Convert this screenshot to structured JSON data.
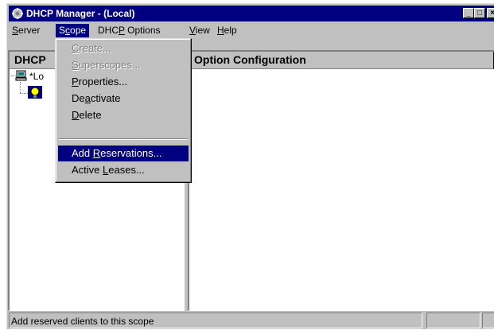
{
  "window": {
    "title": "DHCP Manager - (Local)",
    "icon": "dhcp-manager-icon",
    "controls": {
      "minimize": "_",
      "maximize": "□",
      "close": "×"
    }
  },
  "menubar": {
    "items": [
      {
        "pre": "",
        "key": "S",
        "post": "erver"
      },
      {
        "pre": "S",
        "key": "c",
        "post": "ope"
      },
      {
        "pre": "DHC",
        "key": "P",
        "post": " Options"
      },
      {
        "pre": "",
        "key": "V",
        "post": "iew"
      },
      {
        "pre": "",
        "key": "H",
        "post": "elp"
      }
    ]
  },
  "left_pane": {
    "header": "DHCP",
    "tree": {
      "root_label": "*Lo"
    }
  },
  "right_pane": {
    "header": "Option Configuration"
  },
  "scope_menu": {
    "items": [
      {
        "pre": "",
        "key": "C",
        "post": "reate...",
        "disabled": true
      },
      {
        "pre": "",
        "key": "S",
        "post": "uperscopes...",
        "disabled": true
      },
      {
        "pre": "",
        "key": "P",
        "post": "roperties...",
        "disabled": false
      },
      {
        "pre": "De",
        "key": "a",
        "post": "ctivate",
        "disabled": false
      },
      {
        "pre": "",
        "key": "D",
        "post": "elete",
        "disabled": false
      },
      {
        "pre": "Add ",
        "key": "R",
        "post": "eservations...",
        "disabled": false,
        "highlighted": true
      },
      {
        "pre": "Active ",
        "key": "L",
        "post": "eases...",
        "disabled": false
      }
    ]
  },
  "statusbar": {
    "text": "Add reserved clients to this scope"
  },
  "colors": {
    "title_bar": "#000080",
    "face": "#c0c0c0",
    "highlight": "#000080",
    "disabled_text": "#808080"
  }
}
